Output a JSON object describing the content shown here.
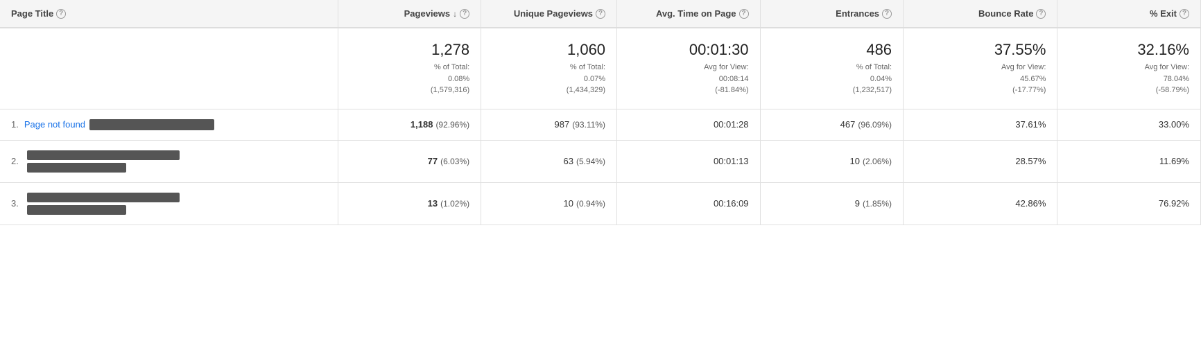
{
  "header": {
    "columns": [
      {
        "id": "page-title",
        "label": "Page Title",
        "hasHelp": true,
        "hasSort": false,
        "align": "left"
      },
      {
        "id": "pageviews",
        "label": "Pageviews",
        "hasHelp": true,
        "hasSort": true,
        "align": "right"
      },
      {
        "id": "unique-pageviews",
        "label": "Unique Pageviews",
        "hasHelp": true,
        "hasSort": false,
        "align": "right"
      },
      {
        "id": "avg-time",
        "label": "Avg. Time on Page",
        "hasHelp": true,
        "hasSort": false,
        "align": "right"
      },
      {
        "id": "entrances",
        "label": "Entrances",
        "hasHelp": true,
        "hasSort": false,
        "align": "right"
      },
      {
        "id": "bounce-rate",
        "label": "Bounce Rate",
        "hasHelp": true,
        "hasSort": false,
        "align": "right"
      },
      {
        "id": "pct-exit",
        "label": "% Exit",
        "hasHelp": true,
        "hasSort": false,
        "align": "right"
      }
    ]
  },
  "summary": {
    "pageviews": {
      "main": "1,278",
      "sub1": "% of Total:",
      "sub2": "0.08%",
      "sub3": "(1,579,316)"
    },
    "unique_pageviews": {
      "main": "1,060",
      "sub1": "% of Total:",
      "sub2": "0.07%",
      "sub3": "(1,434,329)"
    },
    "avg_time": {
      "main": "00:01:30",
      "sub1": "Avg for View:",
      "sub2": "00:08:14",
      "sub3": "(-81.84%)"
    },
    "entrances": {
      "main": "486",
      "sub1": "% of Total:",
      "sub2": "0.04%",
      "sub3": "(1,232,517)"
    },
    "bounce_rate": {
      "main": "37.55%",
      "sub1": "Avg for View:",
      "sub2": "45.67%",
      "sub3": "(-17.77%)"
    },
    "pct_exit": {
      "main": "32.16%",
      "sub1": "Avg for View:",
      "sub2": "78.04%",
      "sub3": "(-58.79%)"
    }
  },
  "rows": [
    {
      "num": "1.",
      "page_title": "Page not found",
      "is_link": true,
      "redacted": true,
      "redacted_width": 180,
      "redacted_height": 16,
      "pageviews_main": "1,188",
      "pageviews_pct": "(92.96%)",
      "unique_main": "987",
      "unique_pct": "(93.11%)",
      "avg_time": "00:01:28",
      "entrances_main": "467",
      "entrances_pct": "(96.09%)",
      "bounce_rate": "37.61%",
      "pct_exit": "33.00%"
    },
    {
      "num": "2.",
      "page_title": "",
      "is_link": true,
      "redacted": true,
      "redacted_width": 220,
      "redacted_height": 30,
      "pageviews_main": "77",
      "pageviews_pct": "(6.03%)",
      "unique_main": "63",
      "unique_pct": "(5.94%)",
      "avg_time": "00:01:13",
      "entrances_main": "10",
      "entrances_pct": "(2.06%)",
      "bounce_rate": "28.57%",
      "pct_exit": "11.69%"
    },
    {
      "num": "3.",
      "page_title": "",
      "is_link": true,
      "redacted": true,
      "redacted_width": 220,
      "redacted_height": 30,
      "pageviews_main": "13",
      "pageviews_pct": "(1.02%)",
      "unique_main": "10",
      "unique_pct": "(0.94%)",
      "avg_time": "00:16:09",
      "entrances_main": "9",
      "entrances_pct": "(1.85%)",
      "bounce_rate": "42.86%",
      "pct_exit": "76.92%"
    }
  ],
  "icons": {
    "help": "?",
    "sort_down": "↓"
  }
}
